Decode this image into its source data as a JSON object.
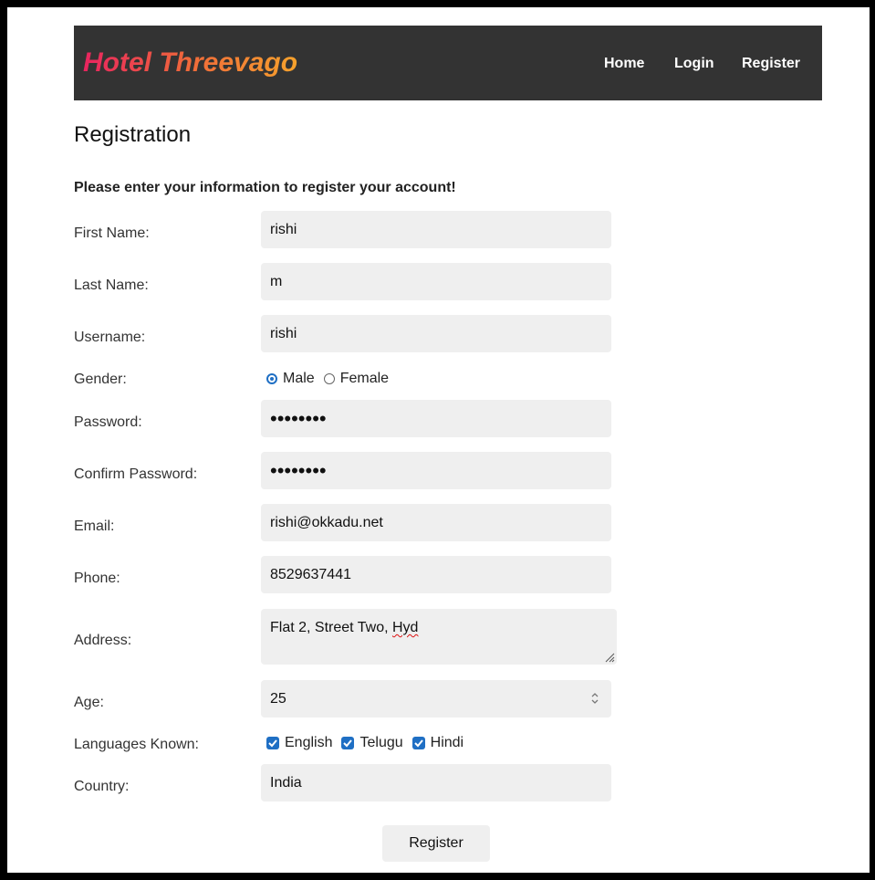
{
  "navbar": {
    "brand": "Hotel Threevago",
    "links": [
      "Home",
      "Login",
      "Register"
    ],
    "background": "#333333",
    "brand_gradient": [
      "#e8245f",
      "#f6a22c"
    ]
  },
  "page": {
    "title": "Registration",
    "intro": "Please enter your information to register your account!"
  },
  "form": {
    "first_name": {
      "label": "First Name:",
      "value": "rishi"
    },
    "last_name": {
      "label": "Last Name:",
      "value": "m"
    },
    "username": {
      "label": "Username:",
      "value": "rishi"
    },
    "gender": {
      "label": "Gender:",
      "options": [
        "Male",
        "Female"
      ],
      "selected": "Male"
    },
    "password": {
      "label": "Password:",
      "value": "••••••••"
    },
    "confirm_password": {
      "label": "Confirm Password:",
      "value": "••••••••"
    },
    "email": {
      "label": "Email:",
      "value": "rishi@okkadu.net"
    },
    "phone": {
      "label": "Phone:",
      "value": "8529637441"
    },
    "address": {
      "label": "Address:",
      "value_prefix": "Flat 2, Street Two, ",
      "value_flagged": "Hyd"
    },
    "age": {
      "label": "Age:",
      "value": "25"
    },
    "languages": {
      "label": "Languages Known:",
      "options": [
        "English",
        "Telugu",
        "Hindi"
      ],
      "checked": [
        "English",
        "Telugu",
        "Hindi"
      ]
    },
    "country": {
      "label": "Country:",
      "value": "India"
    },
    "submit_label": "Register"
  },
  "accent_color": "#1f6fc4"
}
